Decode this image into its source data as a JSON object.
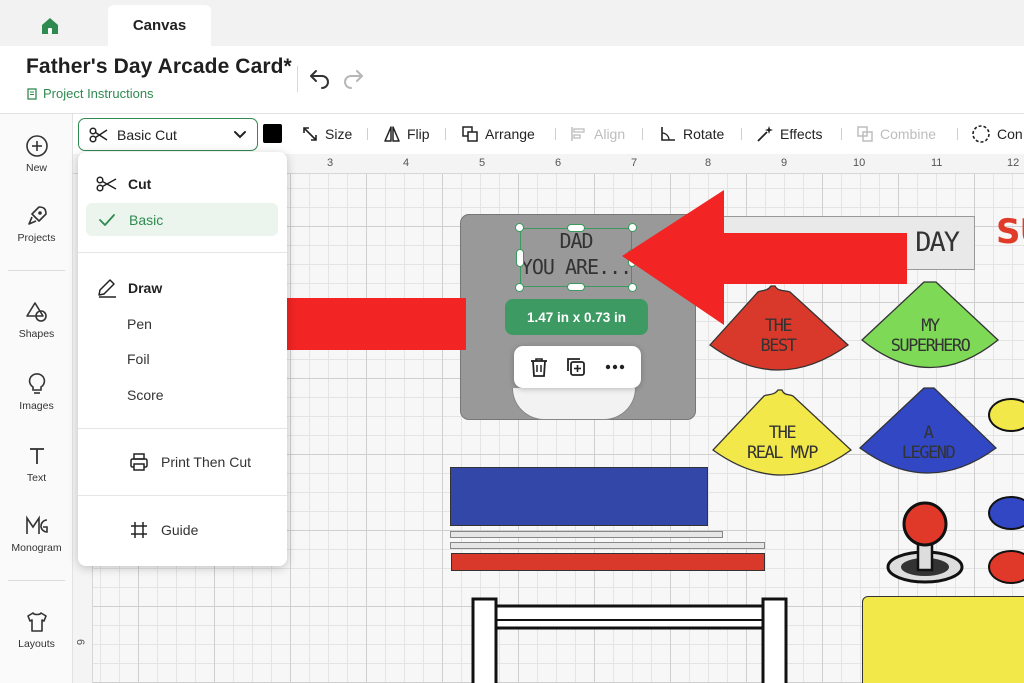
{
  "tabs": {
    "home_icon": "home-icon",
    "canvas_label": "Canvas"
  },
  "header": {
    "project_title": "Father's Day Arcade Card*",
    "project_instructions": "Project Instructions"
  },
  "sidebar": {
    "items": [
      {
        "label": "New",
        "icon": "plus-circle-icon"
      },
      {
        "label": "Projects",
        "icon": "rocket-icon"
      },
      {
        "label": "Shapes",
        "icon": "shapes-icon"
      },
      {
        "label": "Images",
        "icon": "lightbulb-icon"
      },
      {
        "label": "Text",
        "icon": "text-icon"
      },
      {
        "label": "Monogram",
        "icon": "monogram-icon"
      },
      {
        "label": "Layouts",
        "icon": "tshirt-icon"
      }
    ]
  },
  "toolbar": {
    "operation": "Basic Cut",
    "color": "#000000",
    "size": "Size",
    "flip": "Flip",
    "arrange": "Arrange",
    "align": "Align",
    "rotate": "Rotate",
    "effects": "Effects",
    "combine": "Combine",
    "contour": "Con"
  },
  "ruler": {
    "top": [
      "3",
      "4",
      "5",
      "6",
      "7",
      "8",
      "9",
      "10",
      "11",
      "12"
    ],
    "left": [
      "6"
    ]
  },
  "operation_menu": {
    "cut_heading": "Cut",
    "cut_basic": "Basic",
    "draw_heading": "Draw",
    "draw_items": [
      "Pen",
      "Foil",
      "Score"
    ],
    "print_then_cut": "Print Then Cut",
    "guide": "Guide"
  },
  "canvas": {
    "card_text_line1": "DAD",
    "card_text_line2": "YOU ARE...",
    "selection_size": "1.47  in x 0.73  in",
    "banner_text": "DAY",
    "partial_text": "SU",
    "cones": [
      {
        "line1": "THE",
        "line2": "BEST",
        "color": "#d9392a"
      },
      {
        "line1": "MY",
        "line2": "SUPERHERO",
        "color": "#7ed957"
      },
      {
        "line1": "THE",
        "line2": "REAL MVP",
        "color": "#f2e84a"
      },
      {
        "line1": "A",
        "line2": "LEGEND",
        "color": "#3247c4"
      }
    ]
  },
  "colors": {
    "accent": "#2f8a4f",
    "arrow": "#f22424"
  }
}
